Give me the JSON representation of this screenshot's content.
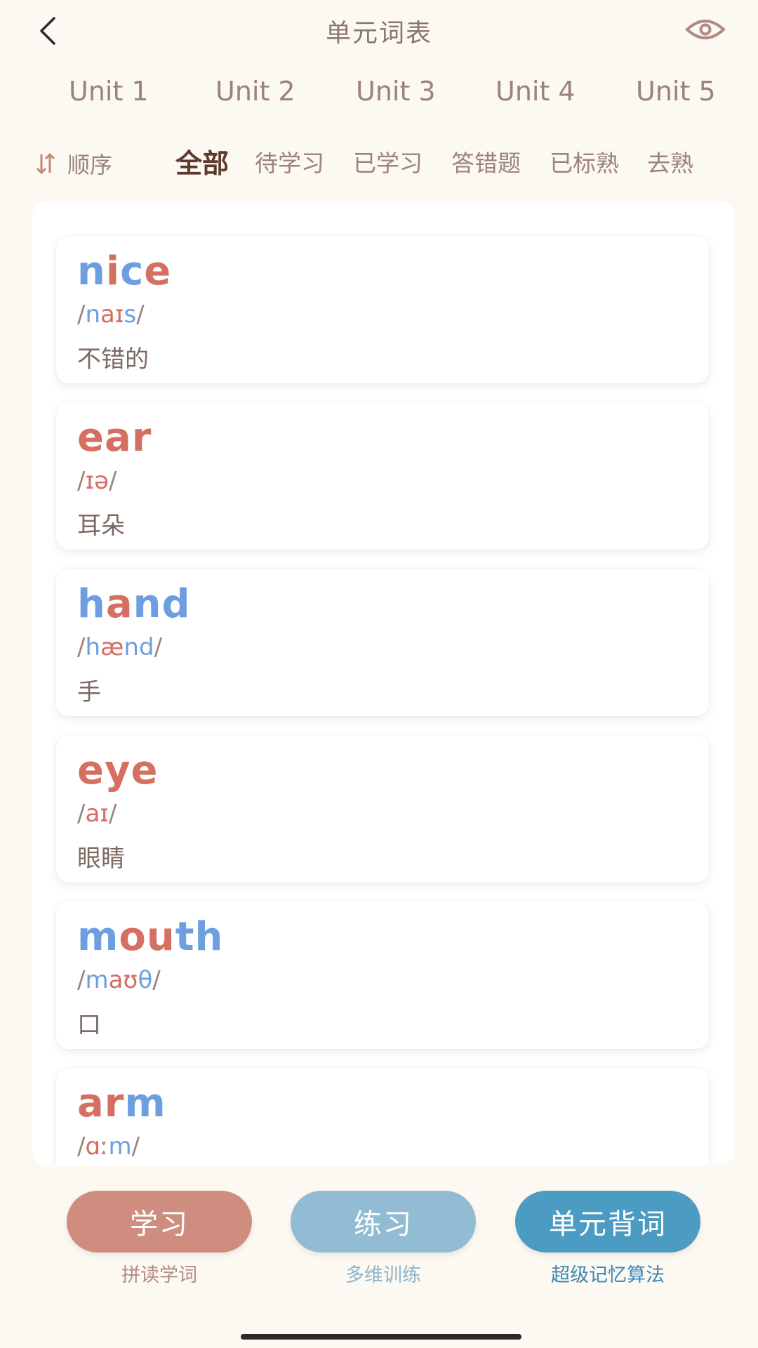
{
  "header": {
    "title": "单元词表",
    "back_icon": "chevron-left-icon",
    "eye_icon": "eye-icon"
  },
  "unit_tabs": [
    {
      "label": "Unit 1",
      "active": true
    },
    {
      "label": "Unit 2",
      "active": false
    },
    {
      "label": "Unit 3",
      "active": false
    },
    {
      "label": "Unit 4",
      "active": false
    },
    {
      "label": "Unit 5",
      "active": false
    }
  ],
  "sort": {
    "label": "顺序",
    "icon": "sort-icon"
  },
  "filters": [
    {
      "label": "全部",
      "active": true
    },
    {
      "label": "待学习",
      "active": false
    },
    {
      "label": "已学习",
      "active": false
    },
    {
      "label": "答错题",
      "active": false
    },
    {
      "label": "已标熟",
      "active": false
    },
    {
      "label": "去熟",
      "active": false
    }
  ],
  "words": [
    {
      "word": "nice",
      "phonetic": "/naɪs/",
      "meaning": "不错的"
    },
    {
      "word": "ear",
      "phonetic": "/ɪə/",
      "meaning": "耳朵"
    },
    {
      "word": "hand",
      "phonetic": "/hænd/",
      "meaning": "手"
    },
    {
      "word": "eye",
      "phonetic": "/aɪ/",
      "meaning": "眼睛"
    },
    {
      "word": "mouth",
      "phonetic": "/maʊθ/",
      "meaning": "口"
    },
    {
      "word": "arm",
      "phonetic": "/ɑːm/",
      "meaning": ""
    }
  ],
  "actions": [
    {
      "label": "学习",
      "sub": "拼读学词",
      "color": "#cf8d80",
      "sub_color": "#b58c82"
    },
    {
      "label": "练习",
      "sub": "多维训练",
      "color": "#92bbd4",
      "sub_color": "#8fb5cd"
    },
    {
      "label": "单元背词",
      "sub": "超级记忆算法",
      "color": "#4b9bc3",
      "sub_color": "#3d88b3"
    }
  ],
  "colors": {
    "blue_letter": "#6d9fe0",
    "red_letter": "#d56f61",
    "accent": "#d87a6e",
    "background": "#fcf8f2"
  }
}
